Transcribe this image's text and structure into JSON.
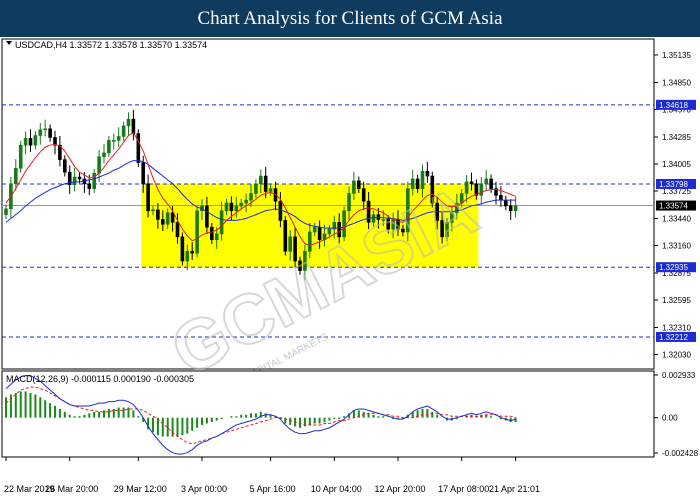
{
  "banner": {
    "title": "Chart Analysis for Clients of GCM Asia"
  },
  "colors": {
    "candle_up": "#1a7a1a",
    "candle_down": "#000000",
    "ma_fast": "#e0202a",
    "ma_slow": "#1c2bd6",
    "range_box": "#ffff00",
    "level_line": "#1c2bd6",
    "level_tag": "#1c2bd6",
    "current_tag": "#000000",
    "macd_hist": "#1a8a1a",
    "macd_signal": "#e0202a",
    "macd_main": "#1c2bd6"
  },
  "watermark": {
    "brand": "GCMASIA",
    "sub": "GCM CAPITAL MARKETS"
  },
  "chart_data": [
    {
      "type": "candlestick",
      "symbol_header": "USDCAD,H4  1.33572 1.33578 1.33570 1.33574",
      "ylim": [
        1.3189,
        1.3528
      ],
      "y_ticks": [
        "1.35135",
        "1.34850",
        "1.34570",
        "1.34285",
        "1.34005",
        "1.33725",
        "1.33440",
        "1.33160",
        "1.32875",
        "1.32595",
        "1.32310",
        "1.32030"
      ],
      "x_labels": [
        "22 Mar 2019",
        "26 Mar 20:00",
        "29 Mar 12:00",
        "3 Apr 00:00",
        "5 Apr 16:00",
        "10 Apr 04:00",
        "12 Apr 20:00",
        "17 Apr 08:00",
        "21 Apr 21:01"
      ],
      "levels": [
        {
          "value": 1.34618,
          "label": "1.34618"
        },
        {
          "value": 1.33798,
          "label": "1.33798"
        },
        {
          "value": 1.32935,
          "label": "1.32935"
        },
        {
          "value": 1.32212,
          "label": "1.32212"
        }
      ],
      "current_price": {
        "value": 1.33574,
        "label": "1.33574"
      },
      "range_box": {
        "x_from": 28,
        "x_to": 96,
        "y_low": 1.32935,
        "y_high": 1.33798
      },
      "closes": [
        1.3354,
        1.338,
        1.3396,
        1.342,
        1.3427,
        1.342,
        1.343,
        1.3436,
        1.3437,
        1.3428,
        1.342,
        1.3405,
        1.3392,
        1.3379,
        1.3387,
        1.3385,
        1.338,
        1.3375,
        1.3391,
        1.3408,
        1.3412,
        1.3425,
        1.3425,
        1.3429,
        1.344,
        1.3447,
        1.3432,
        1.3402,
        1.338,
        1.3352,
        1.3353,
        1.3343,
        1.3338,
        1.335,
        1.334,
        1.3325,
        1.33,
        1.331,
        1.3308,
        1.3352,
        1.3357,
        1.3335,
        1.3322,
        1.3328,
        1.3352,
        1.336,
        1.3352,
        1.3357,
        1.336,
        1.3363,
        1.337,
        1.338,
        1.3388,
        1.3372,
        1.3375,
        1.3362,
        1.3342,
        1.331,
        1.3325,
        1.33,
        1.329,
        1.331,
        1.333,
        1.3335,
        1.3322,
        1.3328,
        1.3333,
        1.334,
        1.3325,
        1.3352,
        1.337,
        1.3383,
        1.3375,
        1.3362,
        1.334,
        1.3348,
        1.3343,
        1.3343,
        1.3333,
        1.3343,
        1.3333,
        1.333,
        1.3375,
        1.3385,
        1.3375,
        1.3393,
        1.3388,
        1.336,
        1.3342,
        1.3325,
        1.334,
        1.335,
        1.336,
        1.337,
        1.3382,
        1.338,
        1.3368,
        1.338,
        1.3385,
        1.3375,
        1.3368,
        1.3363,
        1.3357,
        1.3352,
        1.3357
      ],
      "ma_fast": [
        1.336,
        1.3367,
        1.3375,
        1.3384,
        1.3393,
        1.34,
        1.3407,
        1.3413,
        1.3418,
        1.342,
        1.3421,
        1.3419,
        1.3414,
        1.3406,
        1.3398,
        1.3392,
        1.3389,
        1.3386,
        1.3387,
        1.3391,
        1.3397,
        1.3404,
        1.341,
        1.3416,
        1.3423,
        1.343,
        1.3433,
        1.3424,
        1.3414,
        1.34,
        1.3386,
        1.3374,
        1.3365,
        1.3359,
        1.3352,
        1.3342,
        1.3333,
        1.3326,
        1.3321,
        1.3323,
        1.3327,
        1.3329,
        1.333,
        1.3332,
        1.3336,
        1.3342,
        1.3346,
        1.335,
        1.3354,
        1.3357,
        1.336,
        1.3364,
        1.3368,
        1.337,
        1.3371,
        1.3369,
        1.3364,
        1.3355,
        1.3345,
        1.3335,
        1.3325,
        1.3318,
        1.3316,
        1.3318,
        1.332,
        1.3322,
        1.3325,
        1.3328,
        1.333,
        1.3335,
        1.3342,
        1.3348,
        1.3352,
        1.3354,
        1.3355,
        1.3354,
        1.3352,
        1.335,
        1.3346,
        1.3343,
        1.3341,
        1.334,
        1.3345,
        1.3352,
        1.3357,
        1.3363,
        1.3368,
        1.3369,
        1.3366,
        1.3361,
        1.3357,
        1.3356,
        1.3357,
        1.336,
        1.3364,
        1.3367,
        1.3369,
        1.3371,
        1.3373,
        1.3374,
        1.3374,
        1.3373,
        1.3371,
        1.3369,
        1.3367
      ],
      "ma_slow": [
        1.334,
        1.3344,
        1.3348,
        1.3352,
        1.3357,
        1.3361,
        1.3365,
        1.3368,
        1.3371,
        1.3374,
        1.3376,
        1.3378,
        1.338,
        1.3381,
        1.3382,
        1.3382,
        1.3383,
        1.3384,
        1.3385,
        1.3387,
        1.3389,
        1.3391,
        1.3394,
        1.3396,
        1.3399,
        1.3402,
        1.3404,
        1.3404,
        1.3403,
        1.34,
        1.3396,
        1.3392,
        1.3388,
        1.3384,
        1.338,
        1.3375,
        1.3369,
        1.3364,
        1.3359,
        1.3356,
        1.3354,
        1.3351,
        1.3348,
        1.3345,
        1.3343,
        1.3342,
        1.3342,
        1.3342,
        1.3343,
        1.3344,
        1.3346,
        1.3348,
        1.335,
        1.3352,
        1.3353,
        1.3354,
        1.3353,
        1.3351,
        1.3349,
        1.3346,
        1.3342,
        1.3339,
        1.3337,
        1.3336,
        1.3335,
        1.3334,
        1.3334,
        1.3334,
        1.3334,
        1.3335,
        1.3337,
        1.3339,
        1.3341,
        1.3343,
        1.3344,
        1.3345,
        1.3345,
        1.3345,
        1.3344,
        1.3344,
        1.3343,
        1.3342,
        1.3343,
        1.3344,
        1.3346,
        1.3348,
        1.335,
        1.3351,
        1.3351,
        1.3351,
        1.3351,
        1.3351,
        1.3352,
        1.3353,
        1.3355,
        1.3357,
        1.3358,
        1.3359,
        1.3361,
        1.3362,
        1.3363,
        1.3363,
        1.3363,
        1.3363,
        1.3363
      ]
    },
    {
      "type": "macd",
      "label": "MACD(12,26,9) -0.000115 0.000190 -0.000305",
      "ylim": [
        -0.002428,
        0.002933
      ],
      "y_ticks": [
        "0.002933",
        "0.00",
        "-0.002428"
      ],
      "histogram": [
        0.0014,
        0.0016,
        0.0017,
        0.0018,
        0.0018,
        0.0017,
        0.0016,
        0.0014,
        0.0012,
        0.001,
        0.0008,
        0.0006,
        0.0004,
        0.0002,
        0.0001,
        0.0001,
        0.0002,
        0.0003,
        0.0004,
        0.0004,
        0.0005,
        0.0006,
        0.0006,
        0.0007,
        0.0007,
        0.0007,
        0.0005,
        0.0001,
        -0.0003,
        -0.0008,
        -0.001,
        -0.0012,
        -0.0013,
        -0.0013,
        -0.0013,
        -0.0013,
        -0.0012,
        -0.0011,
        -0.0009,
        -0.0007,
        -0.0005,
        -0.0004,
        -0.0003,
        -0.0002,
        -0.0001,
        0.0,
        0.0001,
        0.0001,
        0.0002,
        0.0002,
        0.0003,
        0.0003,
        0.0004,
        0.0003,
        0.0002,
        0.0001,
        -0.0001,
        -0.0004,
        -0.0005,
        -0.0006,
        -0.0007,
        -0.0006,
        -0.0005,
        -0.0004,
        -0.0004,
        -0.0003,
        -0.0002,
        -0.0001,
        -0.0001,
        0.0001,
        0.0003,
        0.0005,
        0.0005,
        0.0004,
        0.0003,
        0.0002,
        0.0001,
        0.0001,
        0.0,
        -0.0001,
        -0.0001,
        -0.0001,
        0.0002,
        0.0004,
        0.0005,
        0.0006,
        0.0006,
        0.0004,
        0.0002,
        0.0,
        -0.0002,
        -0.0002,
        -0.0001,
        0.0,
        0.0001,
        0.0002,
        0.0001,
        0.0002,
        0.0002,
        0.0001,
        0.0,
        -0.0001,
        -0.0002,
        -0.0003,
        -0.0003
      ],
      "signal": [
        0.001,
        0.0013,
        0.0016,
        0.0019,
        0.002,
        0.0021,
        0.0021,
        0.002,
        0.0019,
        0.0017,
        0.0015,
        0.0013,
        0.0011,
        0.0009,
        0.0008,
        0.0007,
        0.0006,
        0.0005,
        0.0005,
        0.0004,
        0.0004,
        0.0004,
        0.0005,
        0.0005,
        0.0005,
        0.0006,
        0.0006,
        0.0006,
        0.0005,
        0.0003,
        0.0001,
        -0.0001,
        -0.0004,
        -0.0007,
        -0.001,
        -0.0013,
        -0.0015,
        -0.0017,
        -0.0018,
        -0.0017,
        -0.0016,
        -0.0015,
        -0.0014,
        -0.0013,
        -0.0011,
        -0.001,
        -0.0009,
        -0.0008,
        -0.0007,
        -0.0006,
        -0.0005,
        -0.0004,
        -0.0003,
        -0.0002,
        -0.0001,
        0.0,
        0.0,
        -0.0001,
        -0.0002,
        -0.0003,
        -0.0004,
        -0.0005,
        -0.0005,
        -0.0005,
        -0.0005,
        -0.0004,
        -0.0004,
        -0.0003,
        -0.0002,
        -0.0002,
        -0.0001,
        0.0,
        0.0001,
        0.0002,
        0.0003,
        0.0003,
        0.0003,
        0.0002,
        0.0002,
        0.0001,
        0.0001,
        0.0,
        0.0,
        0.0,
        0.0001,
        0.0002,
        0.0002,
        0.0003,
        0.0003,
        0.0002,
        0.0002,
        0.0001,
        0.0001,
        0.0001,
        0.0001,
        0.0001,
        0.0001,
        0.0001,
        0.0002,
        0.0002,
        0.0002,
        0.0001,
        0.0001,
        0.0001,
        0.0
      ],
      "main": [
        0.002,
        0.0023,
        0.0026,
        0.0028,
        0.0029,
        0.0029,
        0.0027,
        0.0025,
        0.0022,
        0.0019,
        0.0016,
        0.0013,
        0.0011,
        0.0009,
        0.0008,
        0.0008,
        0.0008,
        0.0008,
        0.0009,
        0.001,
        0.001,
        0.0011,
        0.0011,
        0.0012,
        0.0012,
        0.0011,
        0.0009,
        0.0005,
        0.0,
        -0.0006,
        -0.0011,
        -0.0015,
        -0.0019,
        -0.0022,
        -0.0024,
        -0.0025,
        -0.0025,
        -0.0024,
        -0.0022,
        -0.0019,
        -0.0017,
        -0.0016,
        -0.0014,
        -0.0013,
        -0.0011,
        -0.0009,
        -0.0007,
        -0.0005,
        -0.0004,
        -0.0003,
        -0.0002,
        -0.0001,
        0.0001,
        0.0002,
        0.0002,
        0.0001,
        -0.0001,
        -0.0005,
        -0.0008,
        -0.001,
        -0.0011,
        -0.0011,
        -0.001,
        -0.0009,
        -0.0009,
        -0.0008,
        -0.0007,
        -0.0005,
        -0.0003,
        -0.0001,
        0.0002,
        0.0005,
        0.0006,
        0.0006,
        0.0005,
        0.0004,
        0.0003,
        0.0002,
        0.0001,
        0.0,
        -0.0001,
        -0.0001,
        0.0001,
        0.0004,
        0.0006,
        0.0007,
        0.0008,
        0.0006,
        0.0004,
        0.0001,
        -0.0001,
        -0.0001,
        0.0,
        0.0001,
        0.0002,
        0.0003,
        0.0002,
        0.0003,
        0.0004,
        0.0003,
        0.0002,
        0.0,
        -0.0001,
        -0.0002,
        -0.0001
      ]
    }
  ]
}
